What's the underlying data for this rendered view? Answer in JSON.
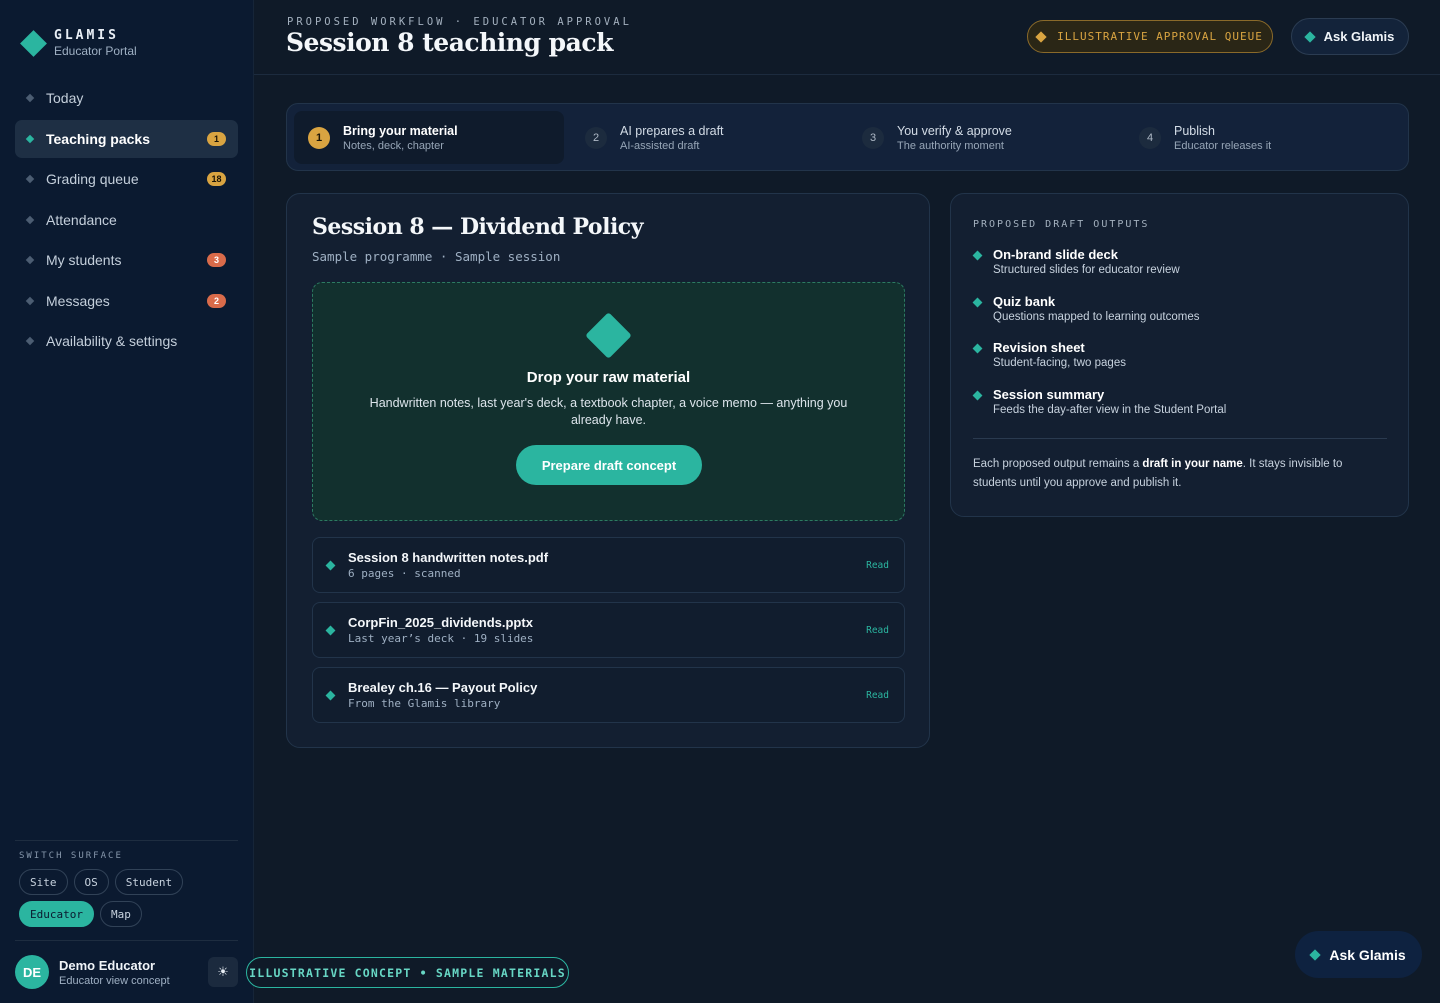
{
  "brand": {
    "name": "GLAMIS",
    "sub": "Educator Portal"
  },
  "nav": {
    "items": [
      {
        "label": "Today",
        "badge": ""
      },
      {
        "label": "Teaching packs",
        "badge": "1"
      },
      {
        "label": "Grading queue",
        "badge": "18"
      },
      {
        "label": "Attendance",
        "badge": ""
      },
      {
        "label": "My students",
        "badge": "3"
      },
      {
        "label": "Messages",
        "badge": "2"
      },
      {
        "label": "Availability & settings",
        "badge": ""
      }
    ]
  },
  "switch_surface": {
    "title": "SWITCH SURFACE",
    "chips": [
      "Site",
      "OS",
      "Student",
      "Educator",
      "Map"
    ],
    "active": "Educator"
  },
  "user": {
    "initials": "DE",
    "name": "Demo Educator",
    "role": "Educator view concept",
    "theme_icon": "☀"
  },
  "header": {
    "eyebrow": "PROPOSED WORKFLOW · EDUCATOR APPROVAL",
    "title": "Session 8 teaching pack",
    "queue_label": "ILLUSTRATIVE APPROVAL QUEUE",
    "ask_label": "Ask Glamis"
  },
  "steps": [
    {
      "num": "1",
      "title": "Bring your material",
      "sub": "Notes, deck, chapter"
    },
    {
      "num": "2",
      "title": "AI prepares a draft",
      "sub": "AI-assisted draft"
    },
    {
      "num": "3",
      "title": "You verify & approve",
      "sub": "The authority moment"
    },
    {
      "num": "4",
      "title": "Publish",
      "sub": "Educator releases it"
    }
  ],
  "session": {
    "title": "Session 8 — Dividend Policy",
    "sub": "Sample programme · Sample session",
    "drop_title": "Drop your raw material",
    "drop_text": "Handwritten notes, last year's deck, a textbook chapter, a voice memo — anything you already have.",
    "drop_button": "Prepare draft concept",
    "files": [
      {
        "name": "Session 8 handwritten notes.pdf",
        "meta": "6 pages · scanned",
        "action": "Read"
      },
      {
        "name": "CorpFin_2025_dividends.pptx",
        "meta": "Last year’s deck · 19 slides",
        "action": "Read"
      },
      {
        "name": "Brealey ch.16 — Payout Policy",
        "meta": "From the Glamis library",
        "action": "Read"
      }
    ]
  },
  "outputs": {
    "eyebrow": "PROPOSED DRAFT OUTPUTS",
    "items": [
      {
        "title": "On-brand slide deck",
        "sub": "Structured slides for educator review"
      },
      {
        "title": "Quiz bank",
        "sub": "Questions mapped to learning outcomes"
      },
      {
        "title": "Revision sheet",
        "sub": "Student-facing, two pages"
      },
      {
        "title": "Session summary",
        "sub": "Feeds the day-after view in the Student Portal"
      }
    ],
    "note_pre": "Each proposed output remains a ",
    "note_bold": "draft in your name",
    "note_post": ". It stays invisible to students until you approve and publish it."
  },
  "footer": {
    "concept_label": "ILLUSTRATIVE CONCEPT • SAMPLE MATERIALS",
    "ask_label": "Ask Glamis"
  },
  "colors": {
    "accent": "#2bb5a0",
    "amber": "#d9a441",
    "background": "#0f1a28",
    "sidebar": "#0b1a30"
  }
}
